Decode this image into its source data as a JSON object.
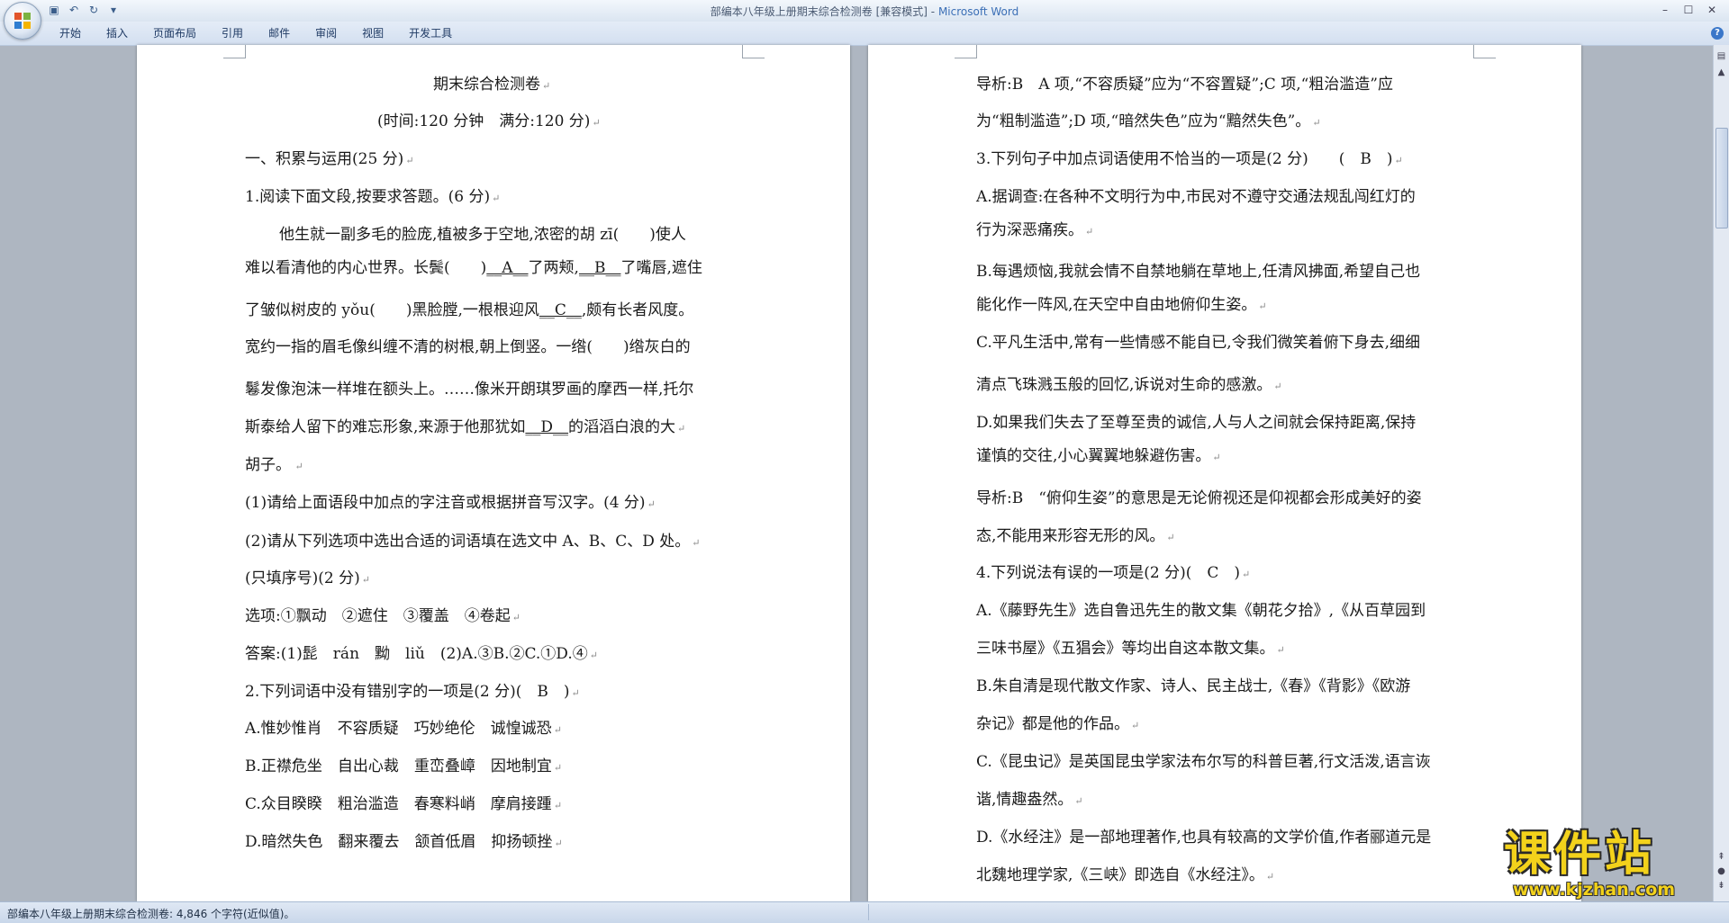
{
  "window": {
    "title": "部编本八年级上册期末综合检测卷 [兼容模式]",
    "separator": " - ",
    "app_name": "Microsoft Word"
  },
  "ribbon": {
    "tabs": [
      "开始",
      "插入",
      "页面布局",
      "引用",
      "邮件",
      "审阅",
      "视图",
      "开发工具"
    ]
  },
  "left_page": {
    "title": "期末综合检测卷",
    "subtitle": "(时间:120 分钟　满分:120 分)",
    "section1": "一、积累与运用(25 分)",
    "q1_head": "1.阅读下面文段,按要求答题。(6 分)",
    "p1": "他生就一副多毛的脸庞,植被多于空地,浓密的胡 zī(　　)使人",
    "p2a": "难以看清他的内心世界。长鬓(　　)",
    "blankA": "__A__",
    "p2b": "了两颊,",
    "blankB": "__B__",
    "p2c": "了嘴唇,遮住",
    "p3a": "了皱似树皮的 yǒu(　　)黑脸膛,一根根迎风",
    "blankC": "__C__",
    "p3b": ",颇有长者风度。",
    "p4": "宽约一指的眉毛像纠缠不清的树根,朝上倒竖。一绺(　　)绺灰白的",
    "p5": "鬈发像泡沫一样堆在额头上。……像米开朗琪罗画的摩西一样,托尔",
    "p6a": "斯泰给人留下的难忘形象,来源于他那犹如",
    "blankD": "__D__",
    "p6b": "的滔滔白浪的大",
    "p7": "胡子。",
    "q1_1": "(1)请给上面语段中加点的字注音或根据拼音写汉字。(4 分)",
    "q1_2": "(2)请从下列选项中选出合适的词语填在选文中 A、B、C、D 处。",
    "q1_2b": "(只填序号)(2 分)",
    "options": "选项:①飘动　②遮住　③覆盖　④卷起",
    "answer": "答案:(1)髭　rán　黝　liǔ　(2)A.③B.②C.①D.④",
    "q2": "2.下列词语中没有错别字的一项是(2 分)(　B　)",
    "q2a": "A.惟妙惟肖　不容质疑　巧妙绝伦　诚惶诚恐",
    "q2b": "B.正襟危坐　自出心裁　重峦叠嶂　因地制宜",
    "q2c": "C.众目睽睽　粗治滥造　春寒料峭　摩肩接踵",
    "q2d": "D.暗然失色　翻来覆去　颔首低眉　抑扬顿挫"
  },
  "right_page": {
    "r1": "导析:B　A 项,“不容质疑”应为“不容置疑”;C 项,“粗治滥造”应",
    "r2": "为“粗制滥造”;D 项,“暗然失色”应为“黯然失色”。",
    "r3": "3.下列句子中加点词语使用不恰当的一项是(2 分)　　(　B　)",
    "r4": "A.据调查:在各种不文明行为中,市民对不遵守交通法规乱闯红灯的",
    "r5": "行为深恶痛疾。",
    "r6": "B.每遇烦恼,我就会情不自禁地躺在草地上,任清风拂面,希望自己也",
    "r7": "能化作一阵风,在天空中自由地俯仰生姿。",
    "r8": "C.平凡生活中,常有一些情感不能自已,令我们微笑着俯下身去,细细",
    "r9": "清点飞珠溅玉般的回忆,诉说对生命的感激。",
    "r10": "D.如果我们失去了至尊至贵的诚信,人与人之间就会保持距离,保持",
    "r11": "谨慎的交往,小心翼翼地躲避伤害。",
    "r12": "导析:B　“俯仰生姿”的意思是无论俯视还是仰视都会形成美好的姿",
    "r13": "态,不能用来形容无形的风。",
    "r14": "4.下列说法有误的一项是(2 分)(　C　)",
    "r15": "A.《藤野先生》选自鲁迅先生的散文集《朝花夕拾》,《从百草园到",
    "r16": "三味书屋》《五猖会》等均出自这本散文集。",
    "r17": "B.朱自清是现代散文作家、诗人、民主战士,《春》《背影》《欧游",
    "r18": "杂记》都是他的作品。",
    "r19": "C.《昆虫记》是英国昆虫学家法布尔写的科普巨著,行文活泼,语言诙",
    "r20": "谐,情趣盎然。",
    "r21": "D.《水经注》是一部地理著作,也具有较高的文学价值,作者郦道元是",
    "r22": "北魏地理学家,《三峡》即选自《水经注》。"
  },
  "status": {
    "text": "部编本八年级上册期末综合检测卷: 4,846 个字符(近似值)。"
  },
  "watermark": {
    "text": "课件站",
    "url": "www.kjzhan.com"
  },
  "colors": {
    "app_name": "#3b6fb6",
    "watermark": "#f3d21b"
  }
}
